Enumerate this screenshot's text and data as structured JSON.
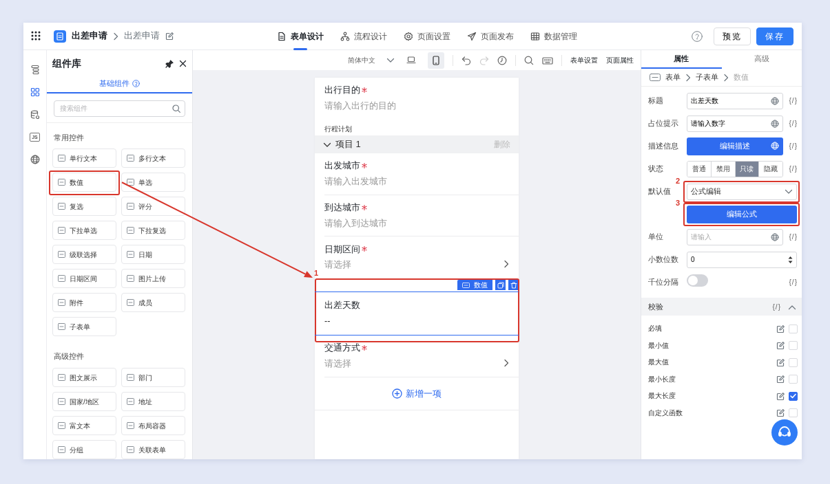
{
  "header": {
    "app_name": "出差申请",
    "breadcrumb": "出差申请",
    "tabs": [
      {
        "label": "表单设计",
        "kind": "form",
        "selected": true
      },
      {
        "label": "流程设计",
        "kind": "flow",
        "selected": false
      },
      {
        "label": "页面设置",
        "kind": "settings",
        "selected": false
      },
      {
        "label": "页面发布",
        "kind": "publish",
        "selected": false
      },
      {
        "label": "数据管理",
        "kind": "data",
        "selected": false
      }
    ],
    "buttons": [
      {
        "label": "预览",
        "kind": "secondary"
      },
      {
        "label": "保存",
        "kind": "primary"
      }
    ]
  },
  "rail": [
    {
      "kind": "tree",
      "selected": false
    },
    {
      "kind": "components",
      "selected": true
    },
    {
      "kind": "database",
      "selected": false
    },
    {
      "kind": "script",
      "text": "JS",
      "selected": false
    },
    {
      "kind": "globe",
      "selected": false
    }
  ],
  "library": {
    "title": "组件库",
    "tab": "基础组件",
    "search": {
      "placeholder": "搜索组件"
    },
    "groups": [
      {
        "title": "常用控件",
        "items": [
          {
            "label": "单行文本",
            "annotated": false
          },
          {
            "label": "多行文本",
            "annotated": false
          },
          {
            "label": "数值",
            "annotated": true
          },
          {
            "label": "单选",
            "annotated": false
          },
          {
            "label": "复选",
            "annotated": false
          },
          {
            "label": "评分",
            "annotated": false
          },
          {
            "label": "下拉单选",
            "annotated": false
          },
          {
            "label": "下拉复选",
            "annotated": false
          },
          {
            "label": "级联选择",
            "annotated": false
          },
          {
            "label": "日期",
            "annotated": false
          },
          {
            "label": "日期区间",
            "annotated": false
          },
          {
            "label": "图片上传",
            "annotated": false
          },
          {
            "label": "附件",
            "annotated": false
          },
          {
            "label": "成员",
            "annotated": false
          },
          {
            "label": "子表单",
            "annotated": false
          }
        ]
      },
      {
        "title": "高级控件",
        "items": [
          {
            "label": "图文展示",
            "annotated": false
          },
          {
            "label": "部门",
            "annotated": false
          },
          {
            "label": "国家/地区",
            "annotated": false
          },
          {
            "label": "地址",
            "annotated": false
          },
          {
            "label": "富文本",
            "annotated": false
          },
          {
            "label": "布局容器",
            "annotated": false
          },
          {
            "label": "分组",
            "annotated": false
          },
          {
            "label": "关联表单",
            "annotated": false
          }
        ]
      }
    ]
  },
  "canvas_toolbar": {
    "language": "简体中文",
    "devices": [
      {
        "kind": "desktop",
        "selected": false
      },
      {
        "kind": "mobile",
        "selected": true
      }
    ],
    "history": [
      {
        "kind": "undo",
        "disabled": false
      },
      {
        "kind": "redo",
        "disabled": true
      },
      {
        "kind": "history",
        "disabled": false
      }
    ],
    "tools": [
      {
        "kind": "search"
      },
      {
        "kind": "keyboard"
      }
    ],
    "links": [
      "表单设置",
      "页面属性"
    ]
  },
  "form": {
    "items": [
      {
        "kind": "field",
        "label": "出行目的",
        "required": true,
        "placeholder": "请输入出行的目的",
        "picker": false,
        "selected": false,
        "annotated": false
      },
      {
        "kind": "section",
        "label": "行程计划"
      },
      {
        "kind": "group",
        "label": "项目 1",
        "action": "删除",
        "expanded": true
      },
      {
        "kind": "field",
        "label": "出发城市",
        "required": true,
        "placeholder": "请输入出发城市",
        "picker": false,
        "selected": false,
        "annotated": false
      },
      {
        "kind": "field",
        "label": "到达城市",
        "required": true,
        "placeholder": "请输入到达城市",
        "picker": false,
        "selected": false,
        "annotated": false
      },
      {
        "kind": "field",
        "label": "日期区间",
        "required": true,
        "placeholder": "请选择",
        "picker": true,
        "selected": false,
        "annotated": false
      },
      {
        "kind": "field",
        "label": "出差天数",
        "required": false,
        "value": "--",
        "picker": false,
        "selected": true,
        "tag": "数值",
        "callout": "1",
        "annotated": true
      },
      {
        "kind": "field",
        "label": "交通方式",
        "required": true,
        "placeholder": "请选择",
        "picker": true,
        "selected": false,
        "annotated": false
      },
      {
        "kind": "add",
        "label": "新增一项"
      }
    ]
  },
  "properties": {
    "tabs": [
      {
        "label": "属性",
        "selected": true
      },
      {
        "label": "高级",
        "selected": false
      }
    ],
    "breadcrumb": [
      {
        "label": "表单",
        "current": false
      },
      {
        "label": "子表单",
        "current": false
      },
      {
        "label": "数值",
        "current": true
      }
    ],
    "rows": [
      {
        "kind": "input",
        "label": "标题",
        "value": "出差天数",
        "translatable": true,
        "binding": "{/}",
        "annotated": false
      },
      {
        "kind": "input",
        "label": "占位提示",
        "value": "请输入数字",
        "translatable": true,
        "binding": "{/}",
        "annotated": false
      },
      {
        "kind": "button",
        "label": "描述信息",
        "button": "编辑描述",
        "translatable": true,
        "binding": "{/}",
        "annotated": false
      },
      {
        "kind": "segmented",
        "label": "状态",
        "options": [
          {
            "label": "普通",
            "selected": false
          },
          {
            "label": "禁用",
            "selected": false
          },
          {
            "label": "只读",
            "selected": true
          },
          {
            "label": "隐藏",
            "selected": false
          }
        ],
        "binding": "{/}",
        "annotated": false
      },
      {
        "kind": "select",
        "label": "默认值",
        "value": "公式编辑",
        "callout": "2",
        "annotated": true
      },
      {
        "kind": "button",
        "button": "编辑公式",
        "callout": "3",
        "annotated": true
      },
      {
        "kind": "input",
        "label": "单位",
        "placeholder": "请输入",
        "translatable": true,
        "binding": "{/}",
        "annotated": false
      },
      {
        "kind": "number",
        "label": "小数位数",
        "value": "0",
        "annotated": false
      },
      {
        "kind": "toggle",
        "label": "千位分隔",
        "on": false,
        "binding": "{/}",
        "annotated": false
      }
    ],
    "validation": {
      "title": "校验",
      "binding": "{/}",
      "expanded": true,
      "rules": [
        {
          "label": "必填",
          "checked": false
        },
        {
          "label": "最小值",
          "checked": false
        },
        {
          "label": "最大值",
          "checked": false
        },
        {
          "label": "最小长度",
          "checked": false
        },
        {
          "label": "最大长度",
          "checked": true
        },
        {
          "label": "自定义函数",
          "checked": false
        }
      ]
    }
  }
}
